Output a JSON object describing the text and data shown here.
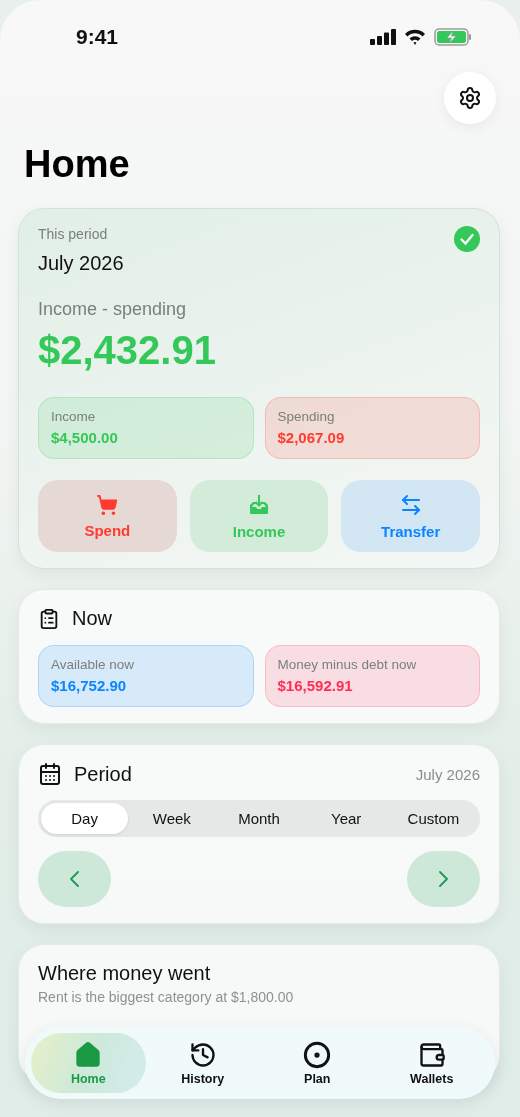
{
  "status_bar": {
    "time": "9:41"
  },
  "header": {
    "title": "Home"
  },
  "summary": {
    "label": "This period",
    "period": "July 2026",
    "completed": true,
    "net_label": "Income - spending",
    "net_value": "$2,432.91",
    "stats": [
      {
        "label": "Income",
        "value": "$4,500.00",
        "color": "#34c759"
      },
      {
        "label": "Spending",
        "value": "$2,067.09",
        "color": "#ff3b30"
      }
    ],
    "actions": [
      {
        "kind": "spend",
        "label": "Spend"
      },
      {
        "kind": "income",
        "label": "Income"
      },
      {
        "kind": "transfer",
        "label": "Transfer"
      }
    ]
  },
  "now": {
    "title": "Now",
    "stats": [
      {
        "label": "Available now",
        "value": "$16,752.90",
        "color": "#0a84ff"
      },
      {
        "label": "Money minus debt now",
        "value": "$16,592.91",
        "color": "#ff2d55"
      }
    ]
  },
  "period": {
    "title": "Period",
    "date": "July 2026",
    "segments": [
      {
        "label": "Day",
        "selected": true
      },
      {
        "label": "Week",
        "selected": false
      },
      {
        "label": "Month",
        "selected": false
      },
      {
        "label": "Year",
        "selected": false
      },
      {
        "label": "Custom",
        "selected": false
      }
    ]
  },
  "where": {
    "title": "Where money went",
    "subtitle": "Rent is the biggest category at $1,800.00"
  },
  "tab_bar": [
    {
      "kind": "home",
      "label": "Home",
      "selected": true
    },
    {
      "kind": "history",
      "label": "History",
      "selected": false
    },
    {
      "kind": "plan",
      "label": "Plan",
      "selected": false
    },
    {
      "kind": "wallets",
      "label": "Wallets",
      "selected": false
    }
  ]
}
